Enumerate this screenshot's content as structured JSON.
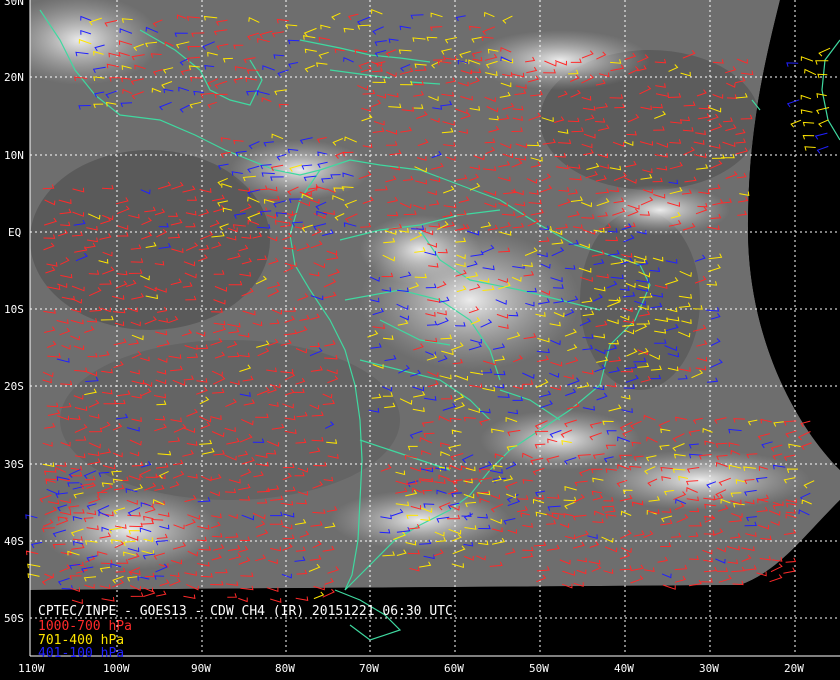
{
  "title": "CPTEC/INPE - GOES13 - CDW CH4 (IR) 20151221 06:30 UTC",
  "legend": [
    {
      "label": "1000-700 hPa",
      "color": "#ff2a2a"
    },
    {
      "label": "701-400 hPa",
      "color": "#ffe600"
    },
    {
      "label": "401-100 hPa",
      "color": "#2020ff"
    }
  ],
  "latitude_labels": [
    "30N",
    "20N",
    "10N",
    "EQ",
    "10S",
    "20S",
    "30S",
    "40S",
    "50S"
  ],
  "longitude_labels": [
    "110W",
    "100W",
    "90W",
    "80W",
    "70W",
    "60W",
    "50W",
    "40W",
    "30W",
    "20W"
  ],
  "colors": {
    "background": "#000000",
    "coastline": "#3fd9a0",
    "grid": "#ffffff",
    "low_level_wind": "#ff2a2a",
    "mid_level_wind": "#ffe600",
    "high_level_wind": "#2020ff"
  }
}
